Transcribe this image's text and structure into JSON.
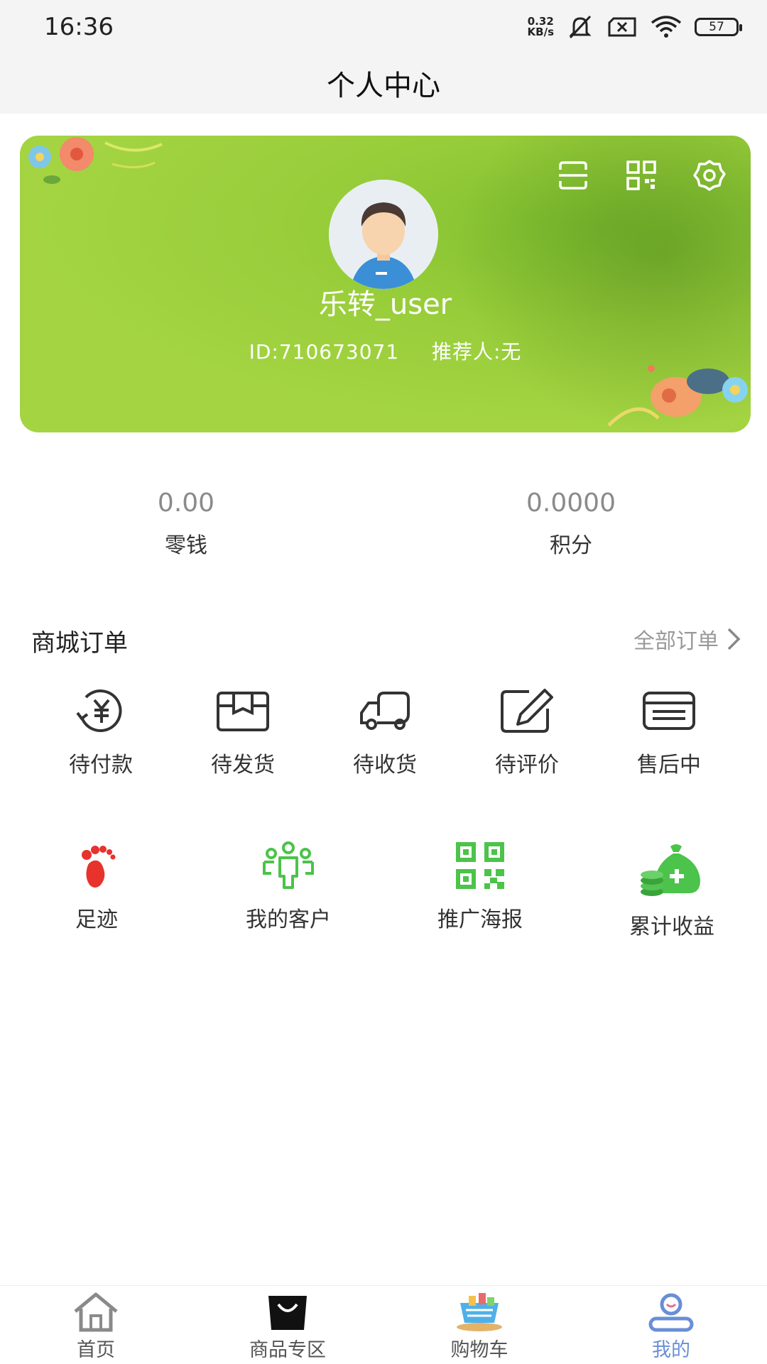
{
  "status_bar": {
    "time": "16:36",
    "net_speed_value": "0.32",
    "net_speed_unit": "KB/s",
    "battery": "57"
  },
  "header": {
    "title": "个人中心"
  },
  "profile": {
    "username": "乐转_user",
    "id_text": "ID:710673071",
    "referrer_text": "推荐人:无",
    "icons": [
      "scan-icon",
      "qr-code-icon",
      "settings-icon"
    ]
  },
  "balance": [
    {
      "value": "0.00",
      "label": "零钱"
    },
    {
      "value": "0.0000",
      "label": "积分"
    }
  ],
  "orders": {
    "title": "商城订单",
    "all_label": "全部订单",
    "items": [
      {
        "label": "待付款",
        "icon": "payment-icon"
      },
      {
        "label": "待发货",
        "icon": "package-icon"
      },
      {
        "label": "待收货",
        "icon": "truck-icon"
      },
      {
        "label": "待评价",
        "icon": "edit-icon"
      },
      {
        "label": "售后中",
        "icon": "card-icon"
      }
    ]
  },
  "tools": [
    {
      "label": "足迹",
      "icon": "footprint-icon",
      "color": "#e8322c"
    },
    {
      "label": "我的客户",
      "icon": "customers-icon",
      "color": "#4cc34a"
    },
    {
      "label": "推广海报",
      "icon": "qr-poster-icon",
      "color": "#4cc34a"
    },
    {
      "label": "累计收益",
      "icon": "money-bag-icon",
      "color": "#4cc34a"
    }
  ],
  "nav": [
    {
      "label": "首页",
      "icon": "home-icon"
    },
    {
      "label": "商品专区",
      "icon": "shopping-bag-icon"
    },
    {
      "label": "购物车",
      "icon": "cart-icon"
    },
    {
      "label": "我的",
      "icon": "user-icon",
      "active": true
    }
  ],
  "colors": {
    "accent": "#4cc34a",
    "card_green": "#a4d442",
    "nav_active": "#6a8ed6"
  }
}
